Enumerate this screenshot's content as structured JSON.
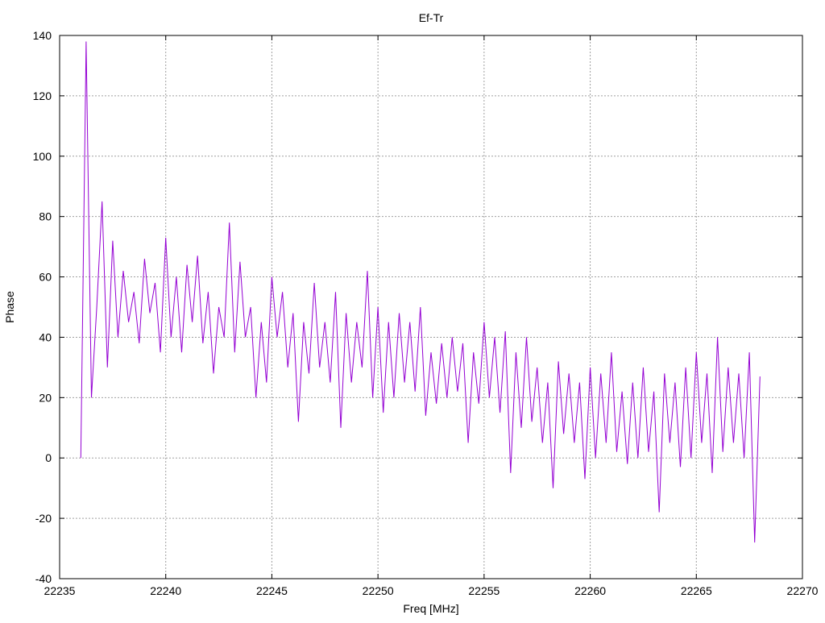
{
  "chart_data": {
    "type": "line",
    "title": "Ef-Tr",
    "xlabel": "Freq [MHz]",
    "ylabel": "Phase",
    "xlim": [
      22235,
      22270
    ],
    "ylim": [
      -40,
      140
    ],
    "xticks": [
      22235,
      22240,
      22245,
      22250,
      22255,
      22260,
      22265,
      22270
    ],
    "yticks": [
      -40,
      -20,
      0,
      20,
      40,
      60,
      80,
      100,
      120,
      140
    ],
    "grid": true,
    "series": [
      {
        "name": "Ef-Tr",
        "color": "#9400d3",
        "x_start": 22236,
        "x_step": 0.25,
        "y": [
          0,
          138,
          20,
          50,
          85,
          30,
          72,
          40,
          62,
          45,
          55,
          38,
          66,
          48,
          58,
          35,
          73,
          40,
          60,
          35,
          64,
          45,
          67,
          38,
          55,
          28,
          50,
          40,
          78,
          35,
          65,
          40,
          50,
          20,
          45,
          25,
          60,
          40,
          55,
          30,
          48,
          12,
          45,
          28,
          58,
          30,
          45,
          25,
          55,
          10,
          48,
          25,
          45,
          30,
          62,
          20,
          50,
          15,
          45,
          20,
          48,
          25,
          45,
          22,
          50,
          14,
          35,
          18,
          38,
          20,
          40,
          22,
          38,
          5,
          35,
          18,
          45,
          20,
          40,
          15,
          42,
          -5,
          35,
          10,
          40,
          12,
          30,
          5,
          25,
          -10,
          32,
          8,
          28,
          5,
          25,
          -7,
          30,
          0,
          28,
          5,
          35,
          2,
          22,
          -2,
          25,
          0,
          30,
          2,
          22,
          -18,
          28,
          5,
          25,
          -3,
          30,
          0,
          35,
          5,
          28,
          -5,
          40,
          2,
          30,
          5,
          28,
          0,
          35,
          -28,
          27
        ]
      }
    ]
  }
}
